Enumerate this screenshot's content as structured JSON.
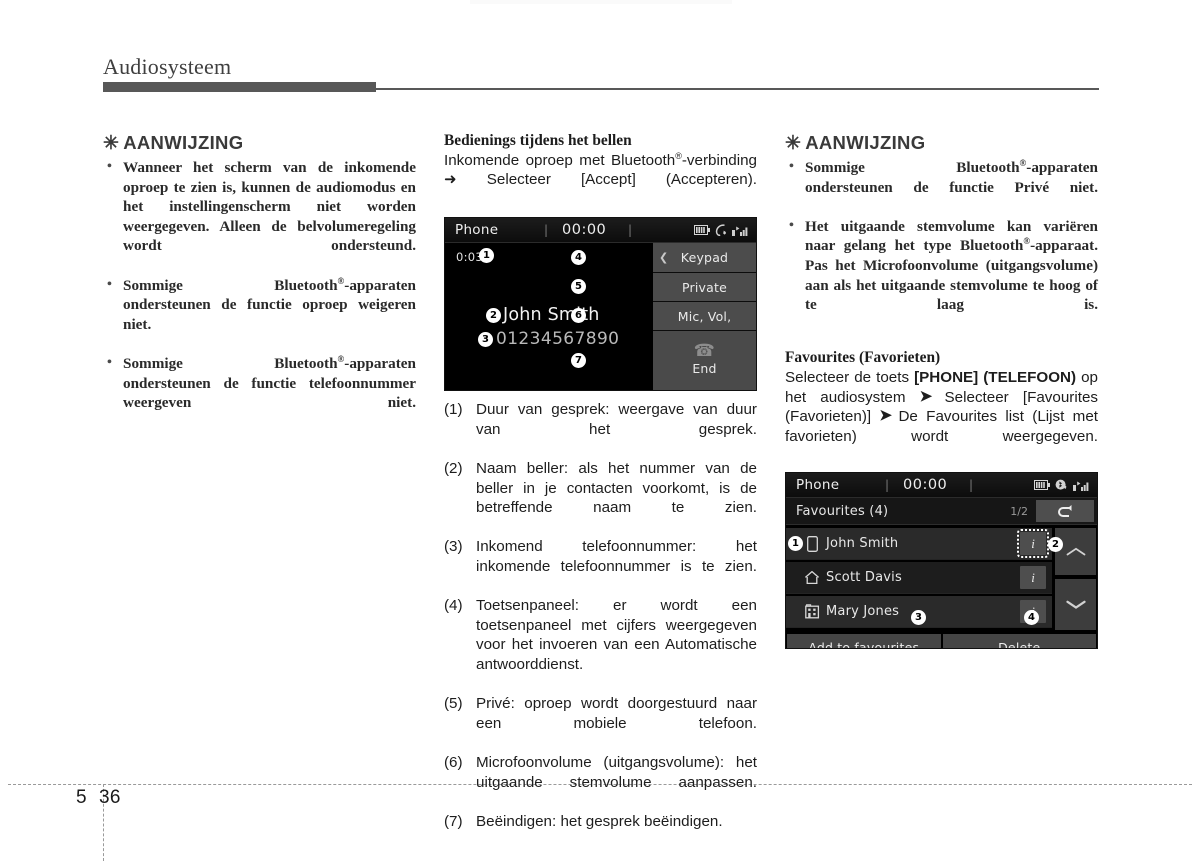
{
  "page": {
    "chapter_title": "Audiosysteem",
    "chapter_number": "5",
    "page_number": "36"
  },
  "column_left": {
    "note_heading": "AANWIJZING",
    "note_asterisk": "✳",
    "bullets": [
      "Wanneer het scherm van de inkomende oproep te zien is, kunnen de audiomodus en het instellingenscherm niet worden weergegeven. Alleen de belvolumeregeling wordt ondersteund.",
      "Sommige Bluetooth®-apparaten ondersteunen de functie oproep weigeren niet.",
      "Sommige Bluetooth®-apparaten ondersteunen de functie telefoonnummer weergeven niet."
    ]
  },
  "column_middle": {
    "sub_heading": "Bedienings tijdens het bellen",
    "intro": "Inkomende oproep met Bluetooth®-verbinding ➜ Selecteer [Accept] (Accepteren).",
    "call_screen": {
      "status_title": "Phone",
      "status_clock": "00:00",
      "icons": [
        "battery-icon",
        "bluetooth-phone-icon",
        "signal-bars-icon"
      ],
      "timer": "0:03",
      "caller_name": "John Smith",
      "caller_number": "01234567890",
      "buttons": [
        {
          "label": "Keypad",
          "callout": "4"
        },
        {
          "label": "Private",
          "callout": "5"
        },
        {
          "label": "Mic, Vol,",
          "callout": "6"
        },
        {
          "label": "End",
          "callout": "7"
        }
      ],
      "callout_timer": "1",
      "callout_name": "2",
      "callout_number": "3"
    },
    "numbered_items": [
      {
        "num": "(1)",
        "text": "Duur van gesprek: weergave van duur van het gesprek."
      },
      {
        "num": "(2)",
        "text": "Naam beller: als het nummer van de beller in je contacten voorkomt, is de betreffende naam te zien."
      },
      {
        "num": "(3)",
        "text": "Inkomend telefoonnummer: het inkomende telefoonnummer is te zien."
      },
      {
        "num": "(4)",
        "text": "Toetsenpaneel: er wordt een toetsenpaneel met cijfers weergegeven voor het invoeren van een Automatische antwoorddienst."
      },
      {
        "num": "(5)",
        "text": "Privé: oproep wordt doorgestuurd naar een mobiele telefoon."
      },
      {
        "num": "(6)",
        "text": "Microfoonvolume (uitgangsvolume): het uitgaande stemvolume aanpassen."
      },
      {
        "num": "(7)",
        "text": "Beëindigen: het gesprek beëindigen."
      }
    ]
  },
  "column_right": {
    "note_heading": "AANWIJZING",
    "note_asterisk": "✳",
    "bullets": [
      "Sommige Bluetooth®-apparaten ondersteunen de functie Privé niet.",
      "Het uitgaande stemvolume kan variëren naar gelang het type Bluetooth®-apparaat. Pas het Microfoonvolume (uitgangsvolume) aan als het uitgaande stemvolume te hoog of te laag is."
    ],
    "sub_heading": "Favourites (Favorieten)",
    "paragraph_parts": {
      "p1": "Selecteer de toets ",
      "b1": "[PHONE] (TELEFOON)",
      "p2": " op het audiosystem ",
      "p3": " Selecteer [Favourites (Favorieten)] ",
      "p4": " De Favourites list (Lijst met favorieten) wordt weergegeven."
    },
    "fav_screen": {
      "status_title": "Phone",
      "status_clock": "00:00",
      "icons": [
        "battery-icon",
        "bluetooth-phone-icon",
        "signal-bars-icon"
      ],
      "list_title": "Favourites (4)",
      "page_indicator": "1/2",
      "back_glyph": "↶",
      "rows": [
        {
          "icon": "mobile-phone-icon",
          "name": "John Smith",
          "info": "i",
          "selected": true
        },
        {
          "icon": "home-icon",
          "name": "Scott Davis",
          "info": "i",
          "selected": false
        },
        {
          "icon": "office-building-icon",
          "name": "Mary Jones",
          "info": "i",
          "selected": false
        }
      ],
      "scroll_up": "⌃",
      "scroll_down": "⌄",
      "footer_buttons": [
        {
          "label": "Add to favourites",
          "callout": "3"
        },
        {
          "label": "Delete",
          "callout": "4"
        }
      ],
      "callout_row1": "1",
      "callout_info": "2"
    }
  },
  "colors": {
    "rule": "#585858",
    "title": "#3f3f3f",
    "body": "#1d1d1d",
    "screen_bg": "#000000",
    "screen_button": "#4c4c4c"
  }
}
